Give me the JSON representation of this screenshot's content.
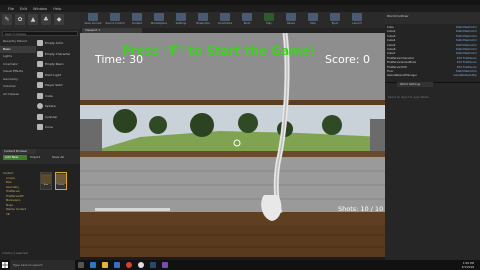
{
  "menu": [
    "File",
    "Edit",
    "Window",
    "Help"
  ],
  "toolbar": [
    "Save Current",
    "Source Control",
    "Content",
    "Marketplace",
    "Settings",
    "Blueprints",
    "Cinematics",
    "Build",
    "Play",
    "Pause",
    "Stop",
    "Eject",
    "Launch"
  ],
  "modes": {
    "search_placeholder": "Search Classes",
    "categories": [
      "Recently Placed",
      "Basic",
      "Lights",
      "Cinematic",
      "Visual Effects",
      "Geometry",
      "Volumes",
      "All Classes"
    ],
    "selected_category": "Basic",
    "actors": [
      "Empty Actor",
      "Empty Character",
      "Empty Pawn",
      "Point Light",
      "Player Start",
      "Cube",
      "Sphere",
      "Cylinder",
      "Cone"
    ]
  },
  "content_browser": {
    "tab": "Content Browser",
    "add_new": "Add New",
    "import": "Import",
    "save_all": "Save All",
    "tree": [
      "Content",
      "Arrows",
      "Bow",
      "Geometry",
      "FirstPerson",
      "FirstPersonBP",
      "Mannequin",
      "Maps",
      "Starter Content",
      "VR"
    ],
    "assets": [
      "Bow",
      "Quiver"
    ],
    "status": "2 items (1 selected)"
  },
  "viewport": {
    "tab": "Viewport 1",
    "hud": {
      "prompt": "Press \"F\" to Start the Game!",
      "time": "Time: 30",
      "score": "Score: 0",
      "shots": "Shots: 10 / 10"
    },
    "colors": {
      "prompt": "#3cd21e",
      "hud_text": "#ffffff"
    }
  },
  "outliner": {
    "title": "World Outliner",
    "rows": [
      [
        "Cube",
        "StaticMeshActor"
      ],
      [
        "Cube2",
        "StaticMeshActor"
      ],
      [
        "Cube3",
        "StaticMeshActor"
      ],
      [
        "Cube4",
        "StaticMeshActor"
      ],
      [
        "Cube5",
        "StaticMeshActor"
      ],
      [
        "Cube6",
        "StaticMeshActor"
      ],
      [
        "Cube7",
        "StaticMeshActor"
      ],
      [
        "FirstPersonCharacter",
        "Edit FirstPerson"
      ],
      [
        "FirstPersonGameMode",
        "Edit FirstPerson"
      ],
      [
        "FirstPersonHUD",
        "Edit FirstPerson"
      ],
      [
        "Floor",
        "StaticMeshActor"
      ],
      [
        "GameNetworkManager",
        "GameNetworkMgr"
      ],
      [
        "GameSession",
        "GameSession"
      ],
      [
        "GameState",
        "GameStateBase"
      ]
    ]
  },
  "details": {
    "tab": "World Settings",
    "message": "Select an object to view details."
  },
  "taskbar": {
    "search": "Type here to search",
    "time": "1:06 PM",
    "date": "3/3/2018"
  }
}
